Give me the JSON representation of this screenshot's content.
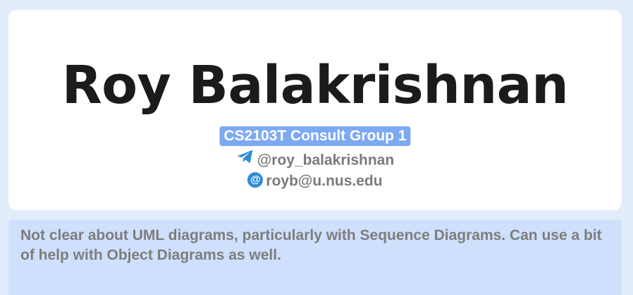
{
  "profile": {
    "name": "Roy Balakrishnan",
    "group": "CS2103T Consult Group 1",
    "telegram": "@roy_balakrishnan",
    "email": "royb@u.nus.edu"
  },
  "notes": {
    "text": "Not clear about UML diagrams, particularly with Sequence Diagrams. Can use a bit of help with Object Diagrams as well."
  },
  "icons": {
    "telegram": "telegram-icon",
    "email": "email-icon"
  },
  "colors": {
    "page_background": "#e3ecfb",
    "card_background": "#ffffff",
    "group_badge": "#7da9f2",
    "notes_background": "#cfe0fc",
    "telegram_icon": "#2f8bd8"
  }
}
